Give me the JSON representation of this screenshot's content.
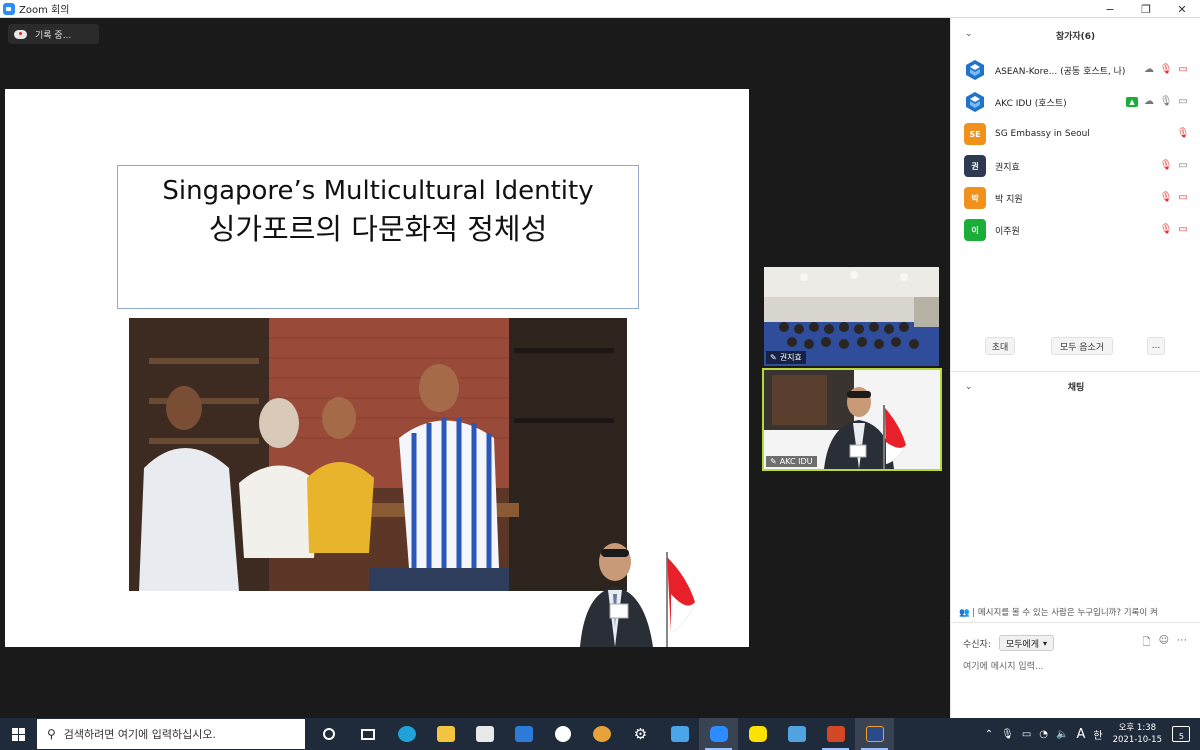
{
  "window": {
    "title": "Zoom 회의",
    "controls": {
      "minimize": "−",
      "maximize": "❐",
      "close": "✕"
    }
  },
  "recording": {
    "label": "기록 중..."
  },
  "slide": {
    "title_en": "Singapore’s Multicultural Identity",
    "title_ko": "싱가포르의 다문화적 정체성"
  },
  "video_tiles": [
    {
      "name": "권지효"
    },
    {
      "name": "AKC IDU"
    }
  ],
  "participants_panel": {
    "title": "참가자(6)",
    "participants": [
      {
        "name": "ASEAN-Kore... (공동 호스트, 나)",
        "avatar": "",
        "avatar_color": "#ffffff"
      },
      {
        "name": "AKC IDU (호스트)",
        "avatar": "",
        "avatar_color": "#ffffff"
      },
      {
        "name": "SG Embassy in Seoul",
        "avatar": "SE",
        "avatar_color": "#f0911c"
      },
      {
        "name": "권지효",
        "avatar": "권",
        "avatar_color": "#2f3a52"
      },
      {
        "name": "박 지원",
        "avatar": "박",
        "avatar_color": "#f0911c"
      },
      {
        "name": "이주원",
        "avatar": "이",
        "avatar_color": "#1aae39"
      }
    ],
    "buttons": {
      "invite": "초대",
      "mute_all": "모두 음소거",
      "more": "..."
    }
  },
  "chat_panel": {
    "title": "채팅",
    "notice": "| 메시지를 볼 수 있는 사람은 누구입니까? 기록이 켜",
    "recipient_label": "수신자:",
    "recipient_value": "모두에게",
    "input_placeholder": "여기에 메시지 입력..."
  },
  "taskbar": {
    "search_placeholder": "검색하려면 여기에 입력하십시오.",
    "tray_ime": "A",
    "tray_lang": "한",
    "clock_ampm_time": "오후 1:38",
    "clock_date": "2021-10-15",
    "notification_count": "5"
  },
  "colors": {
    "accent": "#2d8cff",
    "active_speaker": "#b8d940",
    "mute_red": "#e0302f",
    "taskbar": "#1f2a3a"
  }
}
